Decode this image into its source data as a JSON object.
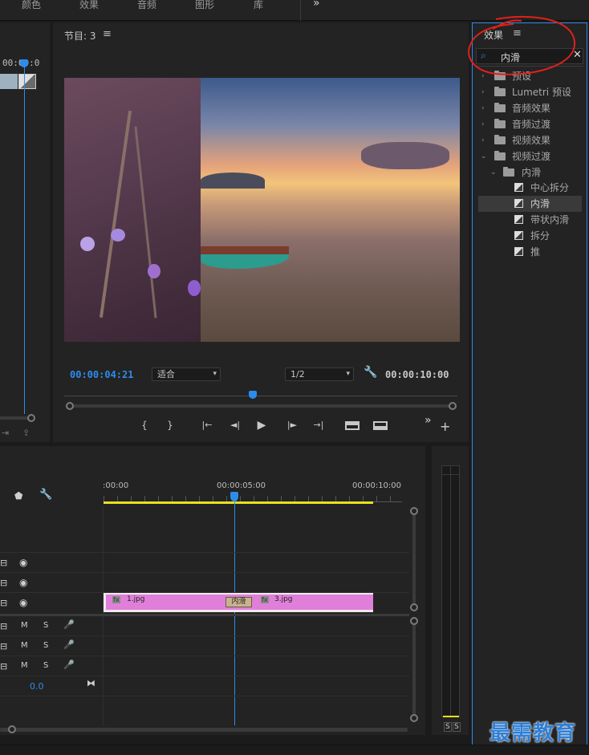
{
  "top_tabs": [
    "颜色",
    "效果",
    "音频",
    "图形",
    "库"
  ],
  "overflow_glyph": "»",
  "source_panel": {
    "timecode_fragment": "00:00:0"
  },
  "program_monitor": {
    "title": "节目: 3",
    "menu_icon": "hamburger-icon",
    "current_time": "00:00:04:21",
    "fit_label": "适合",
    "resolution_label": "1/2",
    "duration": "00:00:10:00",
    "controls": [
      "{",
      "}",
      "|←",
      "◄|",
      "▶",
      "|►",
      "→|"
    ]
  },
  "effects_panel": {
    "title": "效果",
    "search_value": "内滑",
    "tree": [
      {
        "label": "预设",
        "kind": "folder-star",
        "indent": 0,
        "expanded": false
      },
      {
        "label": "Lumetri 预设",
        "kind": "folder-star",
        "indent": 0,
        "expanded": false
      },
      {
        "label": "音频效果",
        "kind": "folder",
        "indent": 0,
        "expanded": false
      },
      {
        "label": "音频过渡",
        "kind": "folder",
        "indent": 0,
        "expanded": false
      },
      {
        "label": "视频效果",
        "kind": "folder",
        "indent": 0,
        "expanded": false
      },
      {
        "label": "视频过渡",
        "kind": "folder",
        "indent": 0,
        "expanded": true
      },
      {
        "label": "内滑",
        "kind": "folder",
        "indent": 1,
        "expanded": true
      },
      {
        "label": "中心拆分",
        "kind": "effect",
        "indent": 2
      },
      {
        "label": "内滑",
        "kind": "effect",
        "indent": 2,
        "selected": true
      },
      {
        "label": "带状内滑",
        "kind": "effect",
        "indent": 2
      },
      {
        "label": "拆分",
        "kind": "effect",
        "indent": 2
      },
      {
        "label": "推",
        "kind": "effect",
        "indent": 2
      }
    ]
  },
  "timeline": {
    "ruler_labels": [
      ":00:00",
      "00:00:05:00",
      "00:00:10:00"
    ],
    "audio_value": "0.0",
    "video_tracks": 3,
    "audio_tracks": 3,
    "track_labels": {
      "m": "M",
      "s": "S"
    },
    "clips": [
      {
        "name": "1.jpg",
        "fx": "fx"
      },
      {
        "name": "3.jpg",
        "fx": "fx"
      }
    ],
    "transition_label": "内滑"
  },
  "audio_meter": {
    "labels": [
      "S",
      "S"
    ]
  },
  "watermark": "最需教育",
  "colors": {
    "accent_blue": "#2d8ceb",
    "clip_pink": "#e07fd9",
    "annotation_red": "#e0201a",
    "work_area_yellow": "#e8e020"
  }
}
